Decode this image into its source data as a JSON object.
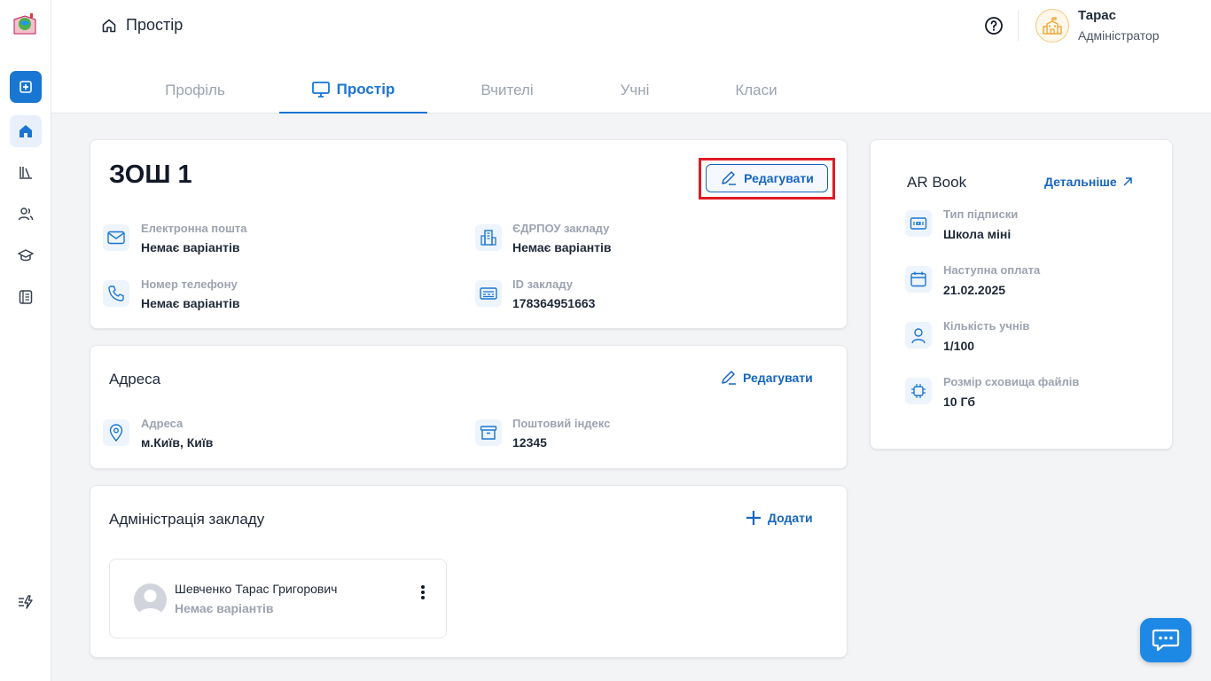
{
  "header": {
    "breadcrumb": "Простір",
    "user": {
      "name": "Тарас",
      "role": "Адміністратор"
    }
  },
  "tabs": [
    {
      "label": "Профіль"
    },
    {
      "label": "Простір"
    },
    {
      "label": "Вчителі"
    },
    {
      "label": "Учні"
    },
    {
      "label": "Класи"
    }
  ],
  "school": {
    "name": "ЗОШ 1",
    "edit_label": "Редагувати",
    "fields": {
      "email_label": "Електронна пошта",
      "email_value": "Немає варіантів",
      "edrpou_label": "ЄДРПОУ закладу",
      "edrpou_value": "Немає варіантів",
      "phone_label": "Номер телефону",
      "phone_value": "Немає варіантів",
      "id_label": "ID закладу",
      "id_value": "178364951663"
    }
  },
  "address": {
    "title": "Адреса",
    "edit_label": "Редагувати",
    "address_label": "Адреса",
    "address_value": "м.Київ, Київ",
    "postal_label": "Поштовий індекс",
    "postal_value": "12345"
  },
  "administration": {
    "title": "Адміністрація закладу",
    "add_label": "Додати",
    "members": [
      {
        "name": "Шевченко Тарас Григорович",
        "sub": "Немає варіантів"
      }
    ]
  },
  "subscription": {
    "title": "AR Book",
    "details_label": "Детальніше",
    "items": [
      {
        "label": "Тип підписки",
        "value": "Школа міні",
        "icon": "ticket-icon"
      },
      {
        "label": "Наступна оплата",
        "value": "21.02.2025",
        "icon": "calendar-icon"
      },
      {
        "label": "Кількість учнів",
        "value": "1/100",
        "icon": "user-icon"
      },
      {
        "label": "Розмір сховища файлів",
        "value": "10 Гб",
        "icon": "chip-icon"
      }
    ]
  },
  "colors": {
    "accent": "#1976d2",
    "highlight": "#e01b24",
    "background": "#f3f4f6"
  }
}
